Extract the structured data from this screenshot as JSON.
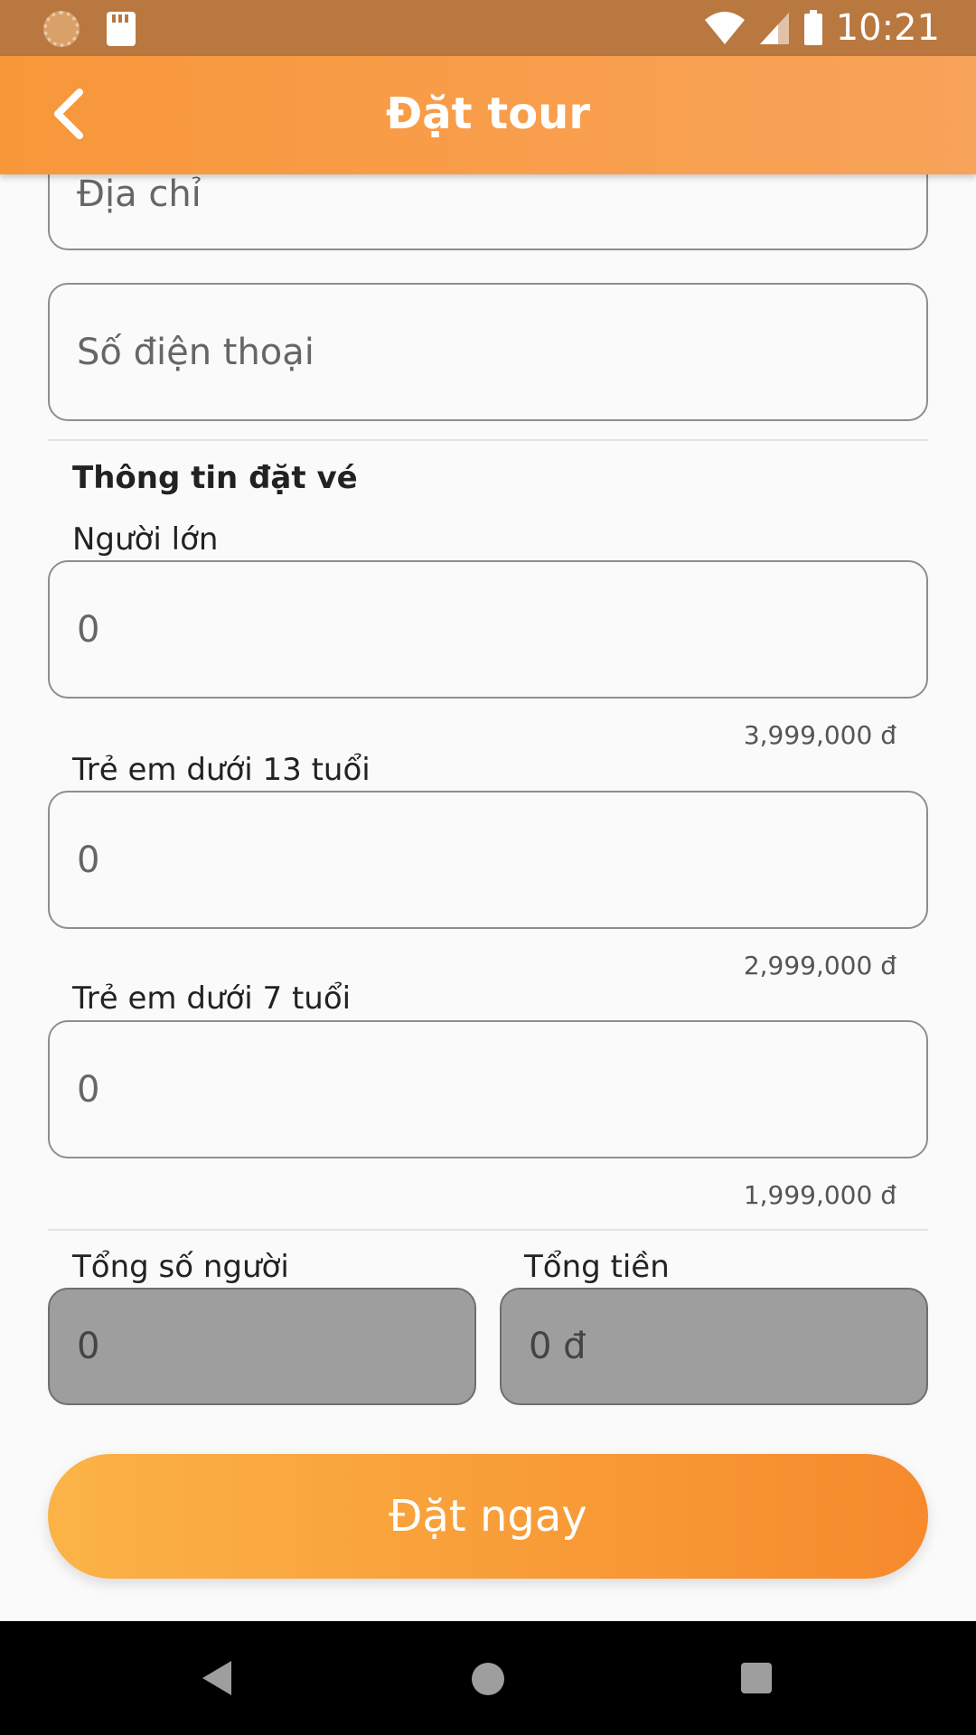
{
  "status_bar": {
    "time": "10:21"
  },
  "app_bar": {
    "title": "Đặt tour"
  },
  "form": {
    "address_placeholder": "Địa chỉ",
    "phone_placeholder": "Số điện thoại",
    "section_title": "Thông tin đặt vé",
    "adult": {
      "label": "Người lớn",
      "value": "0",
      "price": "3,999,000 đ"
    },
    "child13": {
      "label": "Trẻ em dưới 13 tuổi",
      "value": "0",
      "price": "2,999,000 đ"
    },
    "child7": {
      "label": "Trẻ em dưới 7 tuổi",
      "value": "0",
      "price": "1,999,000 đ"
    },
    "total_people": {
      "label": "Tổng số người",
      "value": "0"
    },
    "total_money": {
      "label": "Tổng tiền",
      "value": "0 đ"
    }
  },
  "actions": {
    "book_label": "Đặt ngay"
  },
  "colors": {
    "accent": "#f8973a",
    "status_bar": "#b87840",
    "button_start": "#fbb347",
    "button_end": "#f68a2c"
  }
}
